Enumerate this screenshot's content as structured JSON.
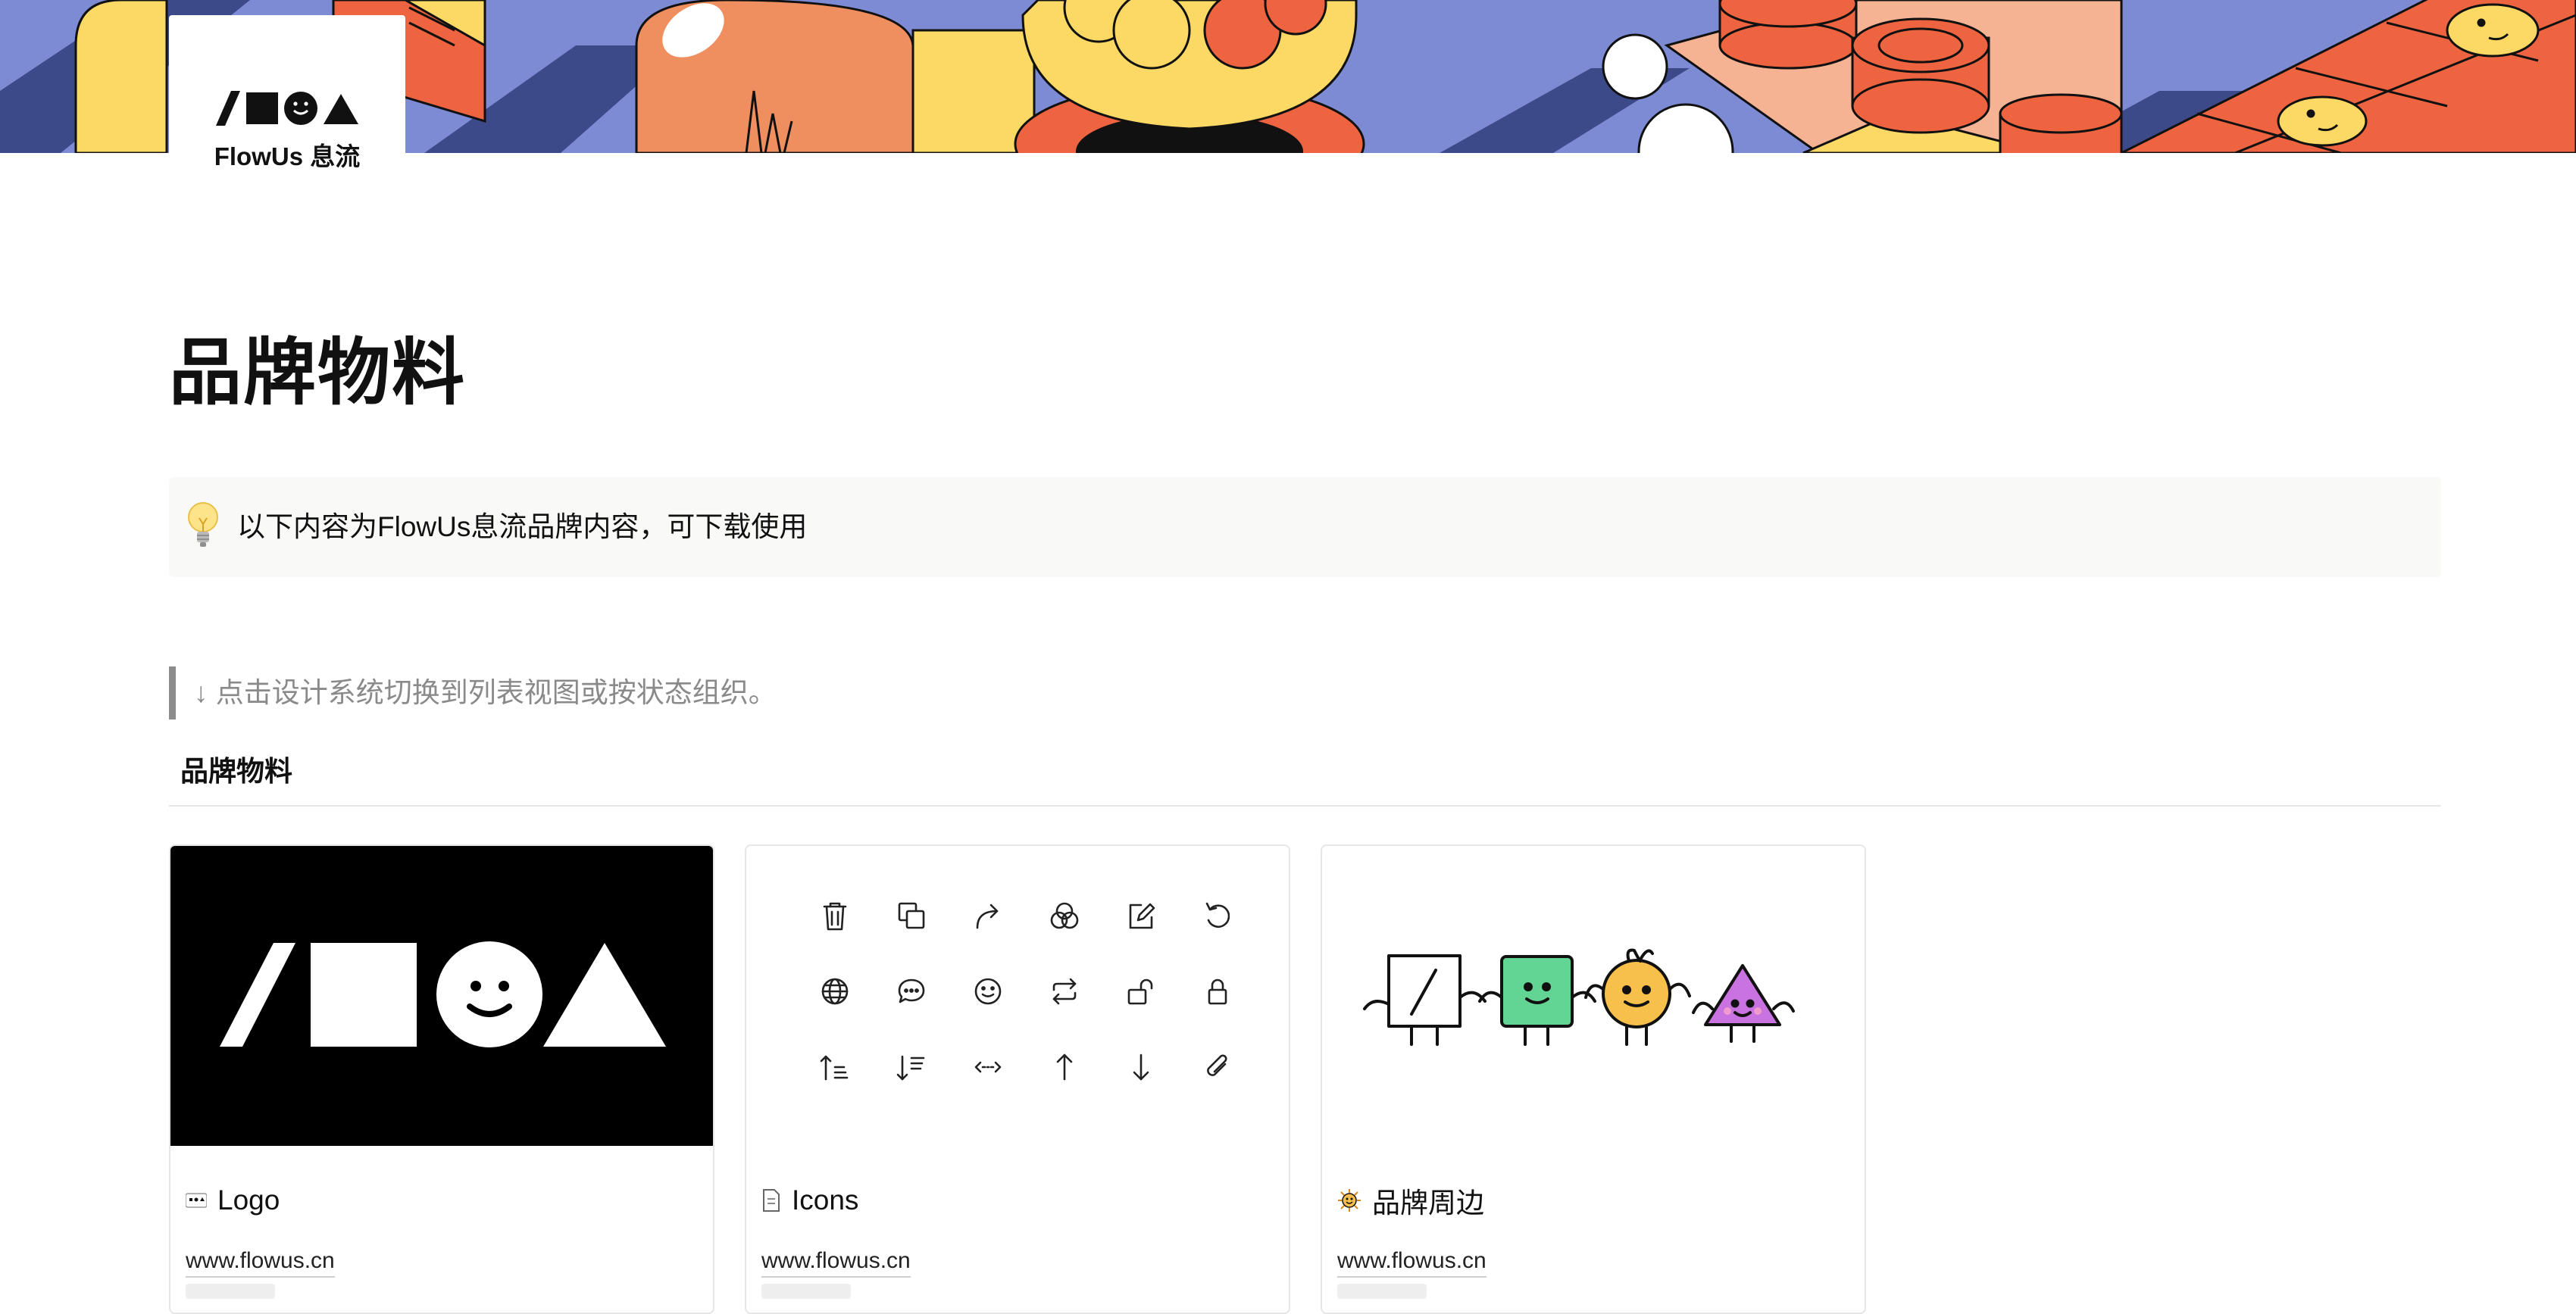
{
  "cover": {
    "brand_name": "FlowUs 息流",
    "colors": {
      "blue": "#7c8bd3",
      "navy": "#3d4a8a",
      "yellow": "#fbd964",
      "orange": "#ef6440",
      "salmon": "#f5b393",
      "black": "#111111"
    }
  },
  "page": {
    "title": "品牌物料",
    "callout": {
      "icon": "lightbulb-icon",
      "text": "以下内容为FlowUs息流品牌内容，可下载使用"
    },
    "quote": "↓ 点击设计系统切换到列表视图或按状态组织。"
  },
  "gallery": {
    "title": "品牌物料",
    "cards": [
      {
        "title": "Logo",
        "icon": "logo-badge-icon",
        "url": "www.flowus.cn",
        "cover": "flowus-logo-marks"
      },
      {
        "title": "Icons",
        "icon": "document-icon",
        "url": "www.flowus.cn",
        "cover": "icon-set"
      },
      {
        "title": "品牌周边",
        "icon": "sun-face-icon",
        "url": "www.flowus.cn",
        "cover": "mascot-characters"
      }
    ],
    "icon_set": [
      "trash-icon",
      "copy-icon",
      "redo-arrow-icon",
      "color-circles-icon",
      "edit-icon",
      "undo-icon",
      "globe-icon",
      "comment-icon",
      "smile-icon",
      "repeat-icon",
      "unlock-icon",
      "lock-icon",
      "sort-ascending-icon",
      "sort-descending-icon",
      "horizontal-arrows-icon",
      "arrow-up-icon",
      "arrow-down-icon",
      "attachment-icon"
    ]
  }
}
